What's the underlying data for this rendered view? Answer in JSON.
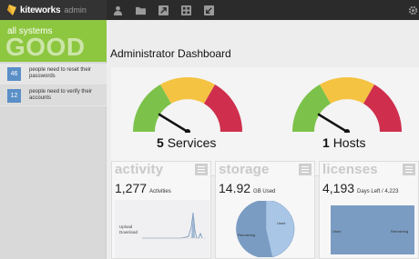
{
  "app": {
    "name": "kiteworks",
    "subtitle": "admin"
  },
  "colors": {
    "accent_green": "#8dc63f",
    "gauge_green": "#7cc24a",
    "gauge_yellow": "#f5c342",
    "gauge_red": "#cf2f4d",
    "badge_blue": "#5b8fc7",
    "pie_dark": "#7a9cc2",
    "pie_light": "#a9c6e6"
  },
  "topnav": {
    "icons": [
      "user-icon",
      "folder-icon",
      "send-icon",
      "grid-icon",
      "download-icon",
      "gear-icon"
    ]
  },
  "sidebar": {
    "status_small": "all systems",
    "status_big": "GOOD",
    "alerts": [
      {
        "count": "46",
        "text": "people need to reset their passwords"
      },
      {
        "count": "12",
        "text": "people need to verify their accounts"
      }
    ]
  },
  "main": {
    "title": "Administrator Dashboard",
    "gauges": [
      {
        "number": "5",
        "label": "Services",
        "level": 0.28
      },
      {
        "number": "1",
        "label": "Hosts",
        "level": 0.28
      }
    ],
    "cards": [
      {
        "title": "activity",
        "value": "1,277",
        "unit": "Activities",
        "legend": [
          "Upload",
          "Download"
        ]
      },
      {
        "title": "storage",
        "value": "14.92",
        "unit": "GB Used",
        "legend": [
          "Used",
          "Remaining"
        ]
      },
      {
        "title": "licenses",
        "value": "4,193",
        "unit": "Days Left / 4,223",
        "legend": [
          "Used",
          "Remaining"
        ]
      }
    ]
  }
}
